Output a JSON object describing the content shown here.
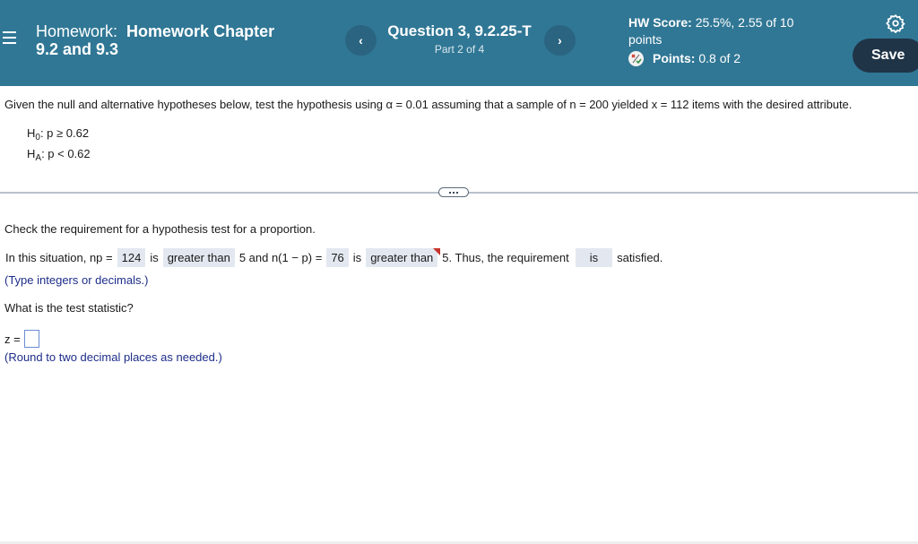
{
  "header": {
    "menu_icon": "hamburger-menu-icon",
    "homework_prefix": "Homework:",
    "homework_name_line1": "Homework Chapter",
    "homework_name_line2": "9.2 and 9.3",
    "prev_label": "‹",
    "next_label": "›",
    "question_title": "Question 3, 9.2.25-T",
    "question_part": "Part 2 of 4",
    "hw_score_label": "HW Score:",
    "hw_score_value": "25.5%, 2.55 of 10",
    "hw_score_unit": "points",
    "points_label": "Points:",
    "points_value": "0.8 of 2",
    "settings_icon": "gear-icon",
    "save_label": "Save",
    "colors": {
      "header_bg": "#307795",
      "save_bg": "#1f3447",
      "nav_bg": "#2a6480"
    }
  },
  "problem": {
    "intro": "Given the null and alternative hypotheses below, test the hypothesis using α = 0.01 assuming that a sample of n = 200 yielded x = 112 items with the desired attribute.",
    "h0_label": "H",
    "h0_sub": "0",
    "h0_text": ": p ≥ 0.62",
    "ha_label": "H",
    "ha_sub": "A",
    "ha_text": ": p < 0.62"
  },
  "part": {
    "check_text": "Check the requirement for a hypothesis test for a proportion.",
    "seg1": "In this situation, np =",
    "np_answer": "124",
    "seg2": "is",
    "comparison1": "greater than",
    "seg3": "5 and n(1 − p) =",
    "nq_answer": "76",
    "seg4": "is",
    "comparison2": "greater than",
    "seg5": "5. Thus, the requirement",
    "requirement_answer": "is",
    "seg6": "satisfied.",
    "hint1": "(Type integers or decimals.)",
    "question": "What is the test statistic?",
    "z_label": "z =",
    "z_value": "",
    "hint2": "(Round to two decimal places as needed.)"
  }
}
